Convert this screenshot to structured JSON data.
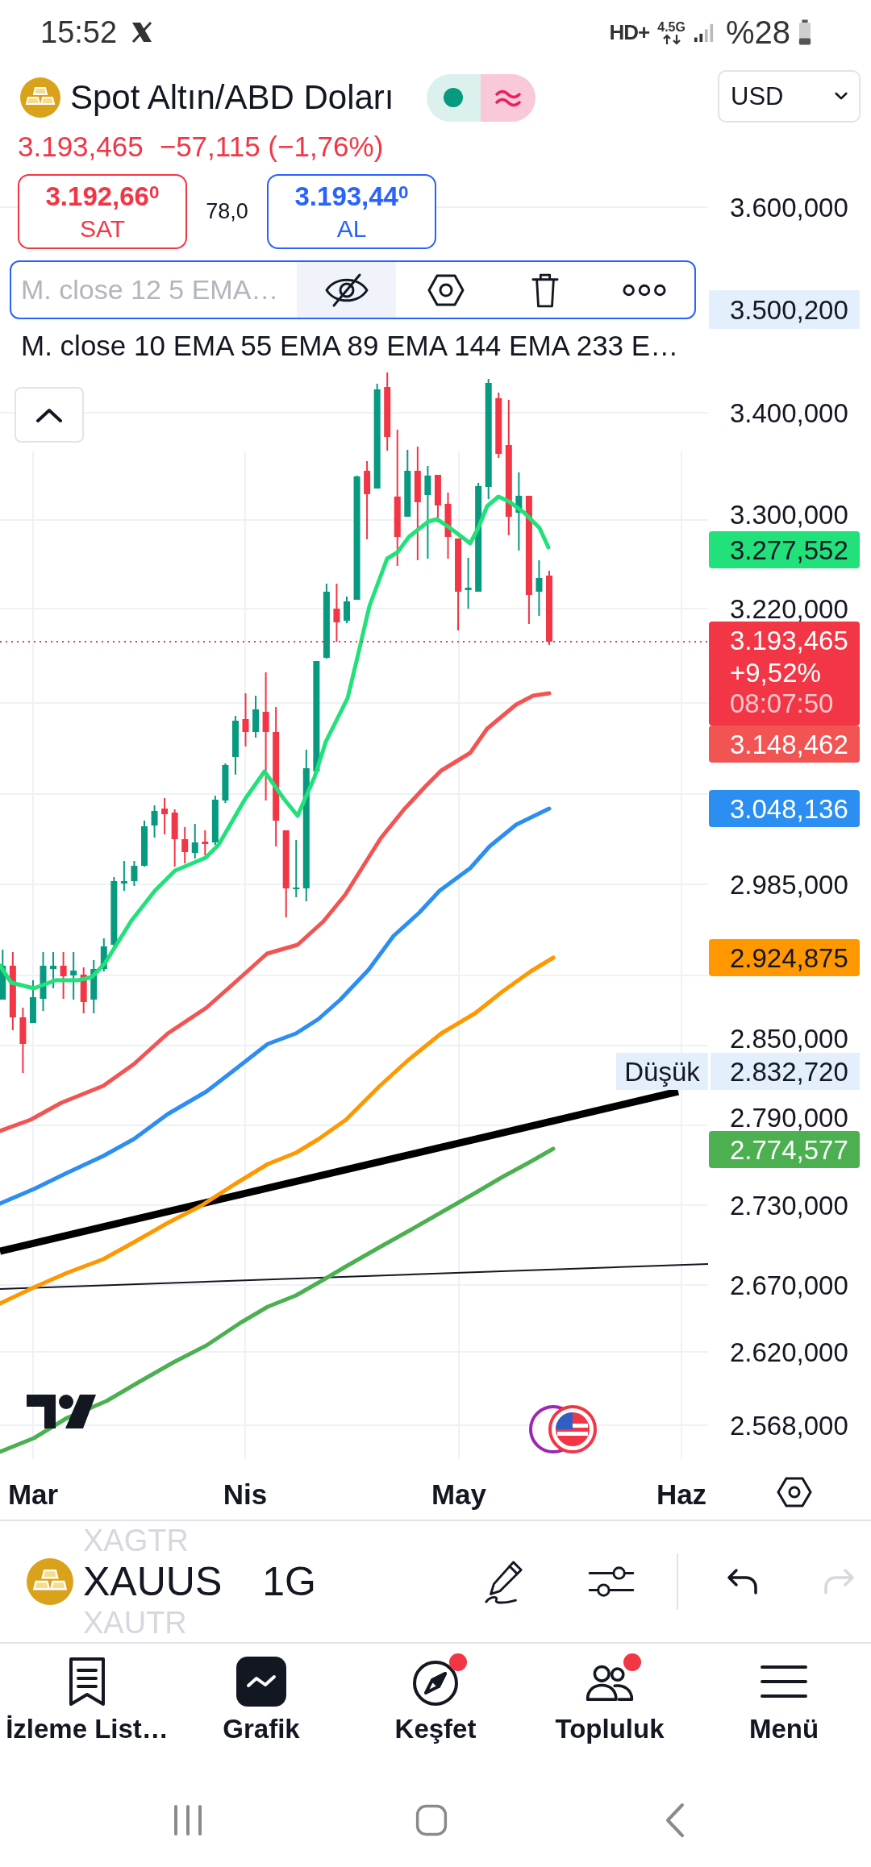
{
  "status_bar": {
    "time": "15:52",
    "hd_badge": "HD+",
    "network": "4.5G",
    "battery": "%28"
  },
  "header": {
    "title": "Spot Altın/ABD Doları",
    "currency": "USD",
    "price": "3.193,465",
    "change": "−57,115 (−1,76%)"
  },
  "quote": {
    "sell": {
      "price": "3.192,66$^{0}$",
      "label": "SAT"
    },
    "spread": "78,0",
    "buy": {
      "price": "3.193,44$^{0}$",
      "label": "AL"
    }
  },
  "indicator": {
    "name": "M. close 12 5 EMA…",
    "hidden": true
  },
  "legend": "M. close 10 EMA 55 EMA 89 EMA 144 EMA 233 E…",
  "price_scale": {
    "ticks": [
      "3.600,000",
      "3.400,000",
      "3.300,000",
      "3.220,000",
      "2.985,000",
      "2.850,000",
      "2.790,000",
      "2.730,000",
      "2.670,000",
      "2.620,000",
      "2.568,000"
    ],
    "markers": [
      {
        "kind": "high",
        "value": "3.500,200"
      },
      {
        "kind": "average",
        "value": "3.277,552",
        "color": "#22e07a"
      },
      {
        "kind": "last",
        "value": "3.193,465",
        "change": "+9,52%",
        "countdown": "08:07:50",
        "color": "#f23645"
      },
      {
        "kind": "average",
        "value": "3.148,462",
        "color": "#f25454"
      },
      {
        "kind": "average",
        "value": "3.048,136",
        "color": "#2b8ef0"
      },
      {
        "kind": "average",
        "value": "2.924,875",
        "color": "#ff9800"
      },
      {
        "kind": "low",
        "label": "Düşük",
        "value": "2.832,720"
      },
      {
        "kind": "average",
        "value": "2.774,577",
        "color": "#4caf50"
      }
    ]
  },
  "time_scale": {
    "labels": [
      "Mar",
      "Nis",
      "May",
      "Haz"
    ]
  },
  "toolbar": {
    "symbols": [
      {
        "label": "XAGTR",
        "selected": false
      },
      {
        "label": "XAUUS",
        "selected": true
      },
      {
        "label": "XAUTR",
        "selected": false
      }
    ],
    "interval": "1G",
    "tools": [
      {
        "disabled": false
      },
      {
        "disabled": false
      },
      {
        "disabled": false
      },
      {
        "disabled": true
      }
    ]
  },
  "nav": [
    {
      "label": "İzleme List…",
      "selected": false,
      "notification": false
    },
    {
      "label": "Grafik",
      "selected": true,
      "notification": false
    },
    {
      "label": "Keşfet",
      "selected": false,
      "notification": true
    },
    {
      "label": "Topluluk",
      "selected": false,
      "notification": true
    },
    {
      "label": "Menü",
      "selected": false,
      "notification": false
    }
  ]
}
